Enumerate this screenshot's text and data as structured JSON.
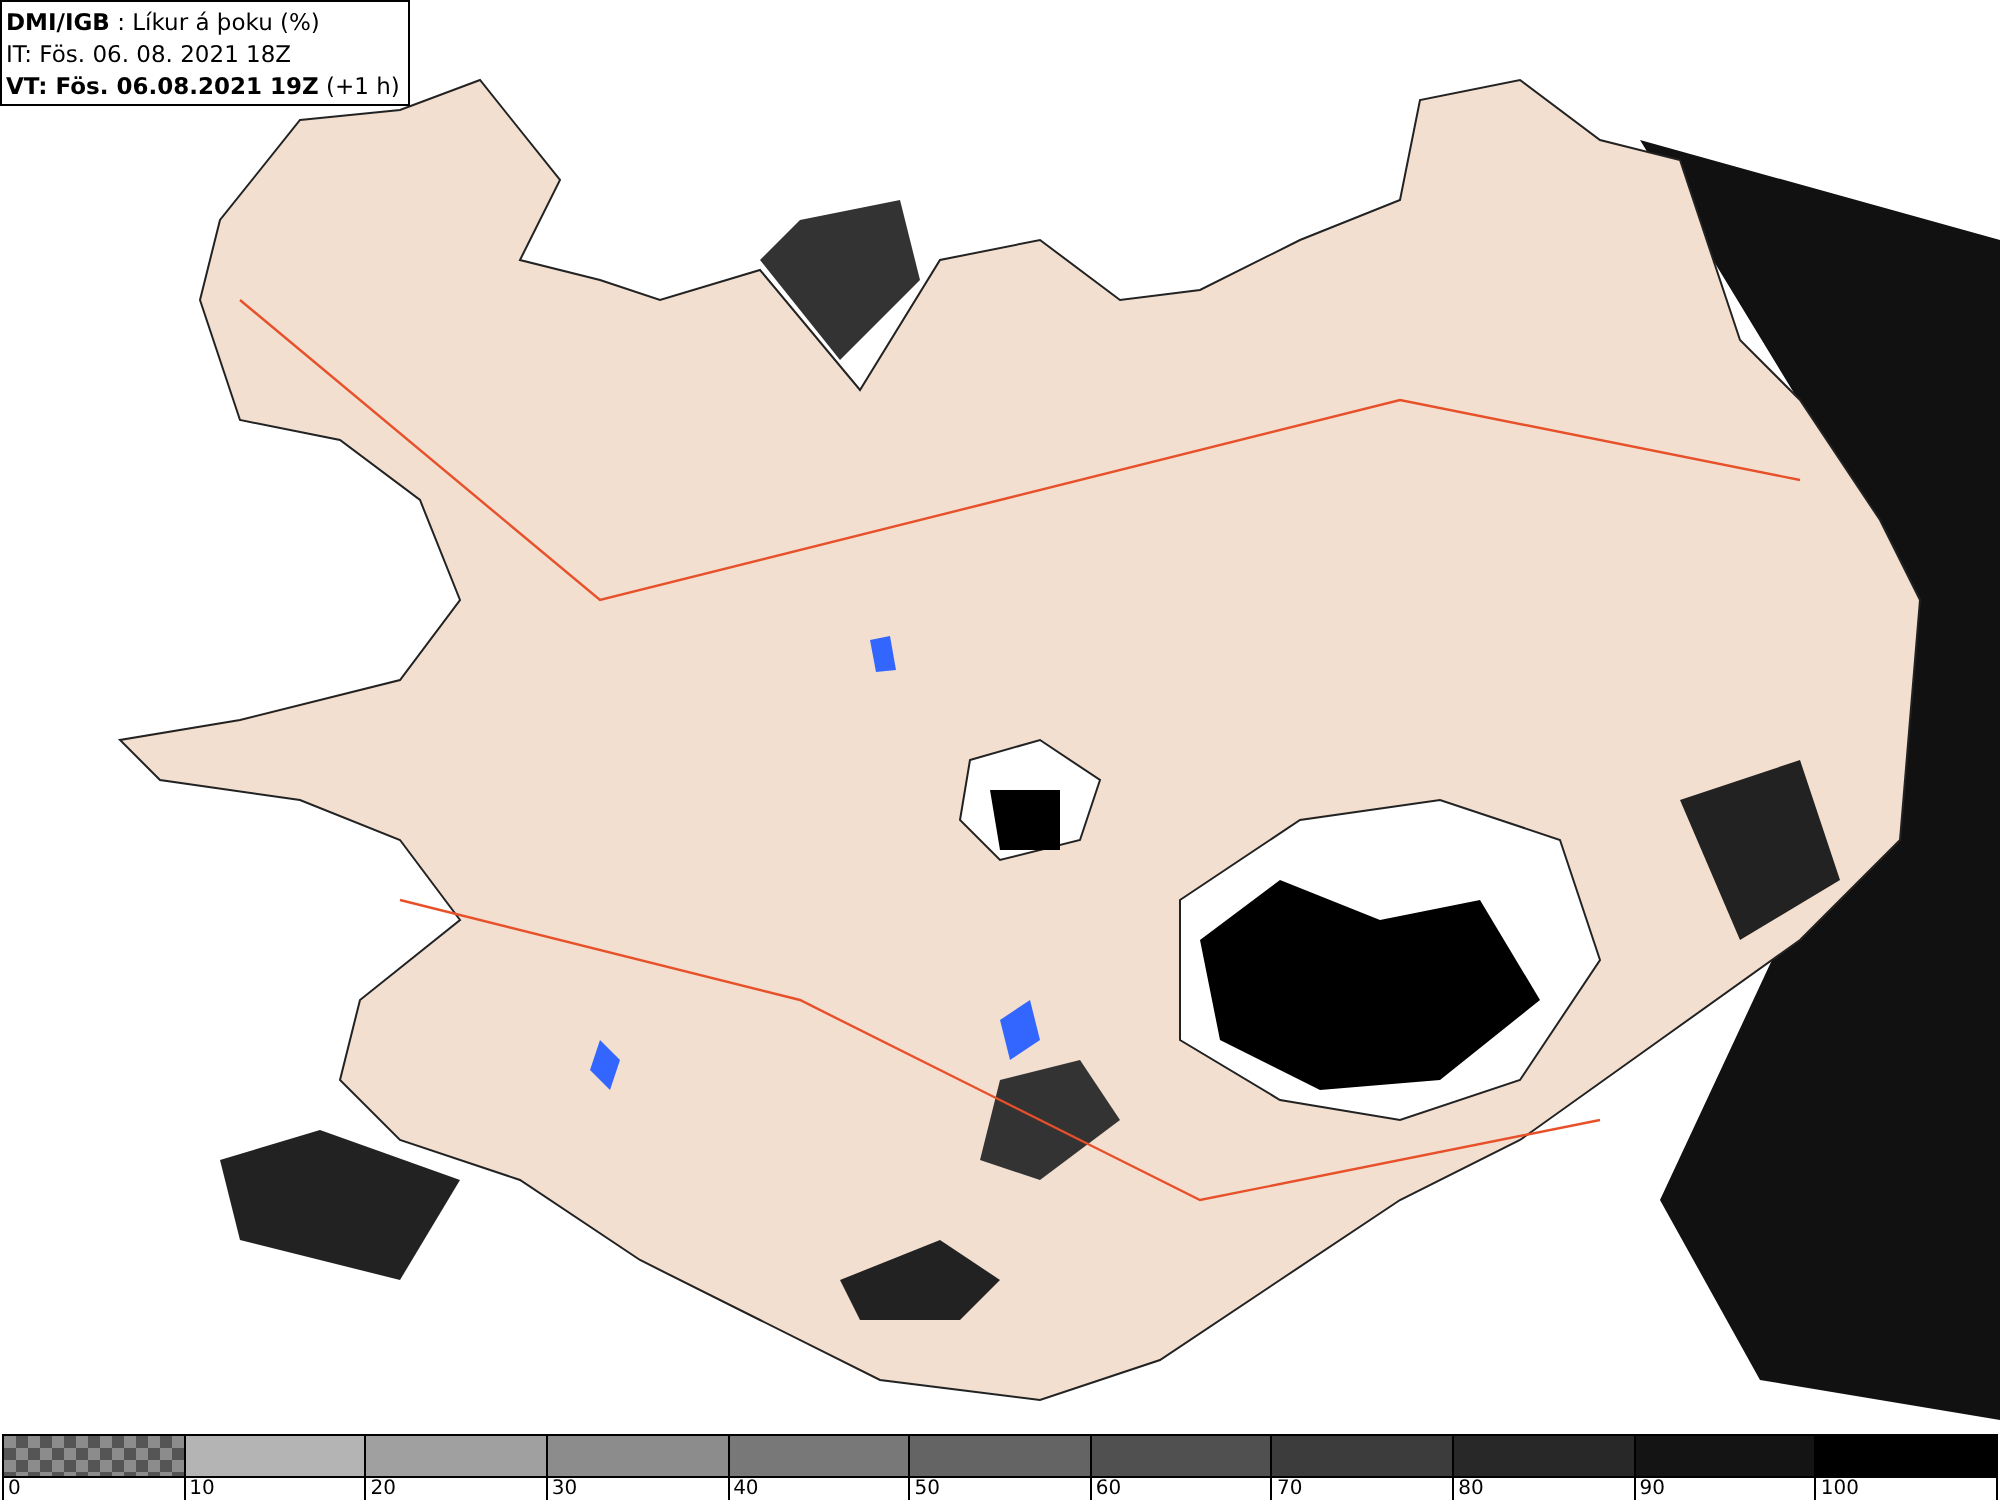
{
  "header": {
    "lines": [
      "**DMI/IGB** : Líkur á þoku (%)",
      "IT: Fös. 06. 08. 2021 18Z",
      "**VT: Fös. 06.08.2021 19Z** (+1 h)"
    ]
  },
  "legend": {
    "segments": [
      {
        "kind": "checker",
        "color": "#8c8c8c"
      },
      {
        "kind": "solid",
        "color": "#b4b4b4"
      },
      {
        "kind": "solid",
        "color": "#a0a0a0"
      },
      {
        "kind": "solid",
        "color": "#8c8c8c"
      },
      {
        "kind": "solid",
        "color": "#787878"
      },
      {
        "kind": "solid",
        "color": "#646464"
      },
      {
        "kind": "solid",
        "color": "#505050"
      },
      {
        "kind": "solid",
        "color": "#3c3c3c"
      },
      {
        "kind": "solid",
        "color": "#282828"
      },
      {
        "kind": "solid",
        "color": "#141414"
      },
      {
        "kind": "solid",
        "color": "#000000"
      }
    ],
    "labels": [
      "0",
      "10",
      "20",
      "30",
      "40",
      "50",
      "60",
      "70",
      "80",
      "90",
      "100"
    ]
  }
}
